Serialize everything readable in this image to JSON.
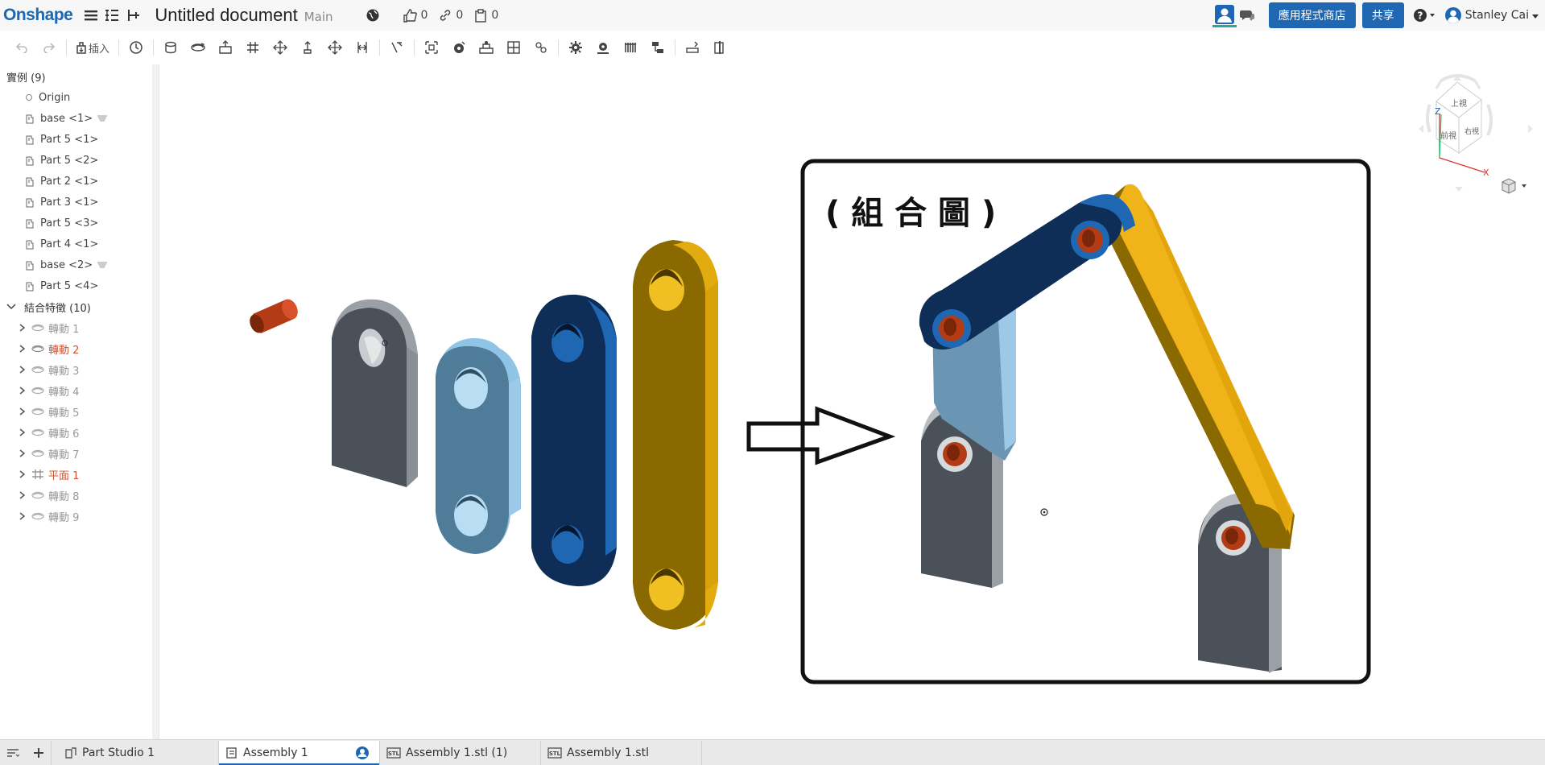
{
  "topbar": {
    "logo": "Onshape",
    "title": "Untitled document",
    "branch": "Main",
    "likes": "0",
    "links": "0",
    "copies": "0",
    "app_store": "應用程式商店",
    "share": "共享",
    "user": "Stanley Cai",
    "help_icon": "question-circle-icon"
  },
  "toolbar": {
    "insert_label": "插入"
  },
  "tree": {
    "instances_header": "實例 (9)",
    "origin": "Origin",
    "instances": [
      "base <1>",
      "Part 5 <1>",
      "Part 5 <2>",
      "Part 2 <1>",
      "Part 3 <1>",
      "Part 5 <3>",
      "Part 4 <1>",
      "base <2>",
      "Part 5 <4>"
    ],
    "mates_header": "結合特徵 (10)",
    "mates": [
      "轉動 1",
      "轉動 2",
      "轉動 3",
      "轉動 4",
      "轉動 5",
      "轉動 6",
      "轉動 7",
      "平面 1",
      "轉動 8",
      "轉動 9"
    ],
    "active_mate_color": "#d9512c",
    "dim_mate_color": "#999999"
  },
  "viewport": {
    "annotation": "( 組 合 圖 )",
    "cube_top": "上視",
    "cube_front": "前視",
    "cube_right": "右視",
    "axis_z": "Z",
    "axis_x": "X"
  },
  "tabs": [
    "Part Studio 1",
    "Assembly 1",
    "Assembly 1.stl (1)",
    "Assembly 1.stl"
  ],
  "colors": {
    "brand": "#1f66b3",
    "gray_part": "#4b5158",
    "light_blue_part": "#4f7d99",
    "dark_blue_part": "#0e2d57",
    "gold_part": "#8a6a00",
    "pin": "#b33c17"
  }
}
